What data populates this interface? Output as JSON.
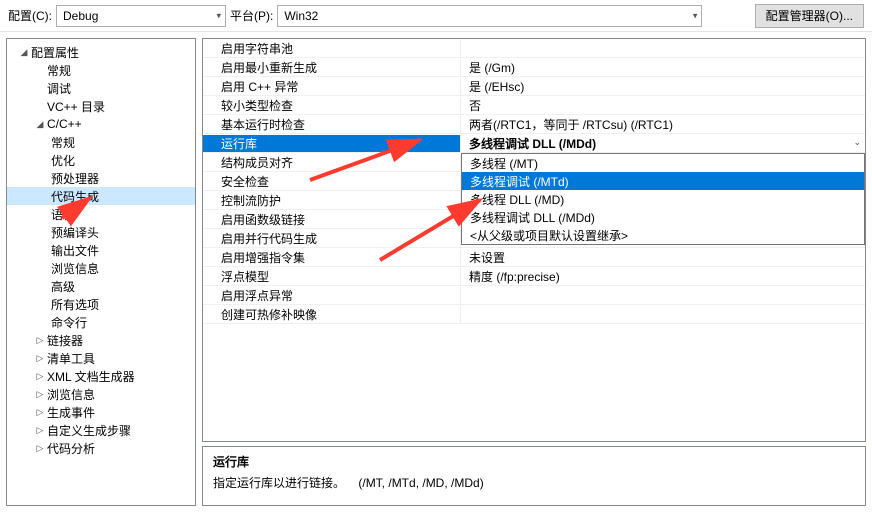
{
  "topbar": {
    "config_label": "配置(C):",
    "config_value": "Debug",
    "platform_label": "平台(P):",
    "platform_value": "Win32",
    "manager_btn": "配置管理器(O)..."
  },
  "tree": {
    "root": "配置属性",
    "items": [
      "常规",
      "调试",
      "VC++ 目录"
    ],
    "cpp": "C/C++",
    "cpp_items": [
      "常规",
      "优化",
      "预处理器",
      "代码生成",
      "语言",
      "预编译头",
      "输出文件",
      "浏览信息",
      "高级",
      "所有选项",
      "命令行"
    ],
    "tail": [
      "链接器",
      "清单工具",
      "XML 文档生成器",
      "浏览信息",
      "生成事件",
      "自定义生成步骤",
      "代码分析"
    ]
  },
  "props": {
    "rows": [
      {
        "n": "启用字符串池",
        "v": ""
      },
      {
        "n": "启用最小重新生成",
        "v": "是 (/Gm)"
      },
      {
        "n": "启用 C++ 异常",
        "v": "是 (/EHsc)"
      },
      {
        "n": "较小类型检查",
        "v": "否"
      },
      {
        "n": "基本运行时检查",
        "v": "两者(/RTC1，等同于 /RTCsu) (/RTC1)"
      },
      {
        "n": "运行库",
        "v": "多线程调试 DLL (/MDd)"
      },
      {
        "n": "结构成员对齐",
        "v": ""
      },
      {
        "n": "安全检查",
        "v": ""
      },
      {
        "n": "控制流防护",
        "v": ""
      },
      {
        "n": "启用函数级链接",
        "v": ""
      },
      {
        "n": "启用并行代码生成",
        "v": ""
      },
      {
        "n": "启用增强指令集",
        "v": "未设置"
      },
      {
        "n": "浮点模型",
        "v": "精度 (/fp:precise)"
      },
      {
        "n": "启用浮点异常",
        "v": ""
      },
      {
        "n": "创建可热修补映像",
        "v": ""
      }
    ],
    "options": [
      "多线程 (/MT)",
      "多线程调试 (/MTd)",
      "多线程 DLL (/MD)",
      "多线程调试 DLL (/MDd)",
      "<从父级或项目默认设置继承>"
    ]
  },
  "desc": {
    "title": "运行库",
    "body_a": "指定运行库以进行链接。",
    "body_b": "(/MT, /MTd, /MD, /MDd)"
  }
}
